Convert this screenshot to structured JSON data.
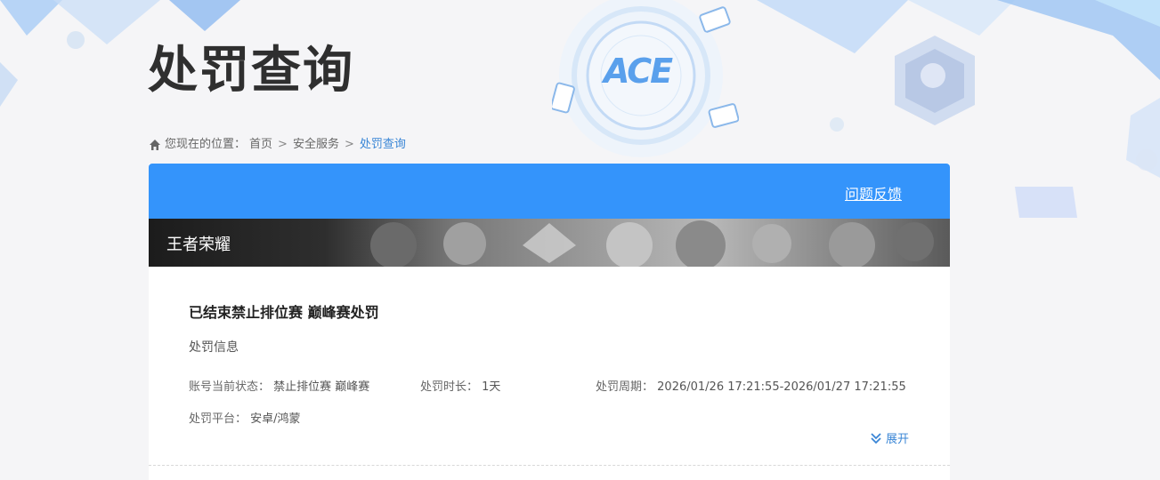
{
  "header": {
    "title": "处罚查询",
    "logo_text": "ACE"
  },
  "breadcrumb": {
    "prefix": "您现在的位置：",
    "items": [
      "首页",
      "安全服务",
      "处罚查询"
    ],
    "separator": ">"
  },
  "panel": {
    "feedback_label": "问题反馈",
    "game_name": "王者荣耀"
  },
  "penalty": {
    "title": "已结束禁止排位赛 巅峰赛处罚",
    "section_label": "处罚信息",
    "status_label": "账号当前状态：",
    "status_value": "禁止排位赛 巅峰赛",
    "duration_label": "处罚时长：",
    "duration_value": "1天",
    "period_label": "处罚周期：",
    "period_value": "2026/01/26 17:21:55-2026/01/27 17:21:55",
    "platform_label": "处罚平台：",
    "platform_value": "安卓/鸿蒙",
    "expand_label": "展开"
  },
  "colors": {
    "accent": "#3494fb",
    "link": "#3a86d6",
    "title": "#2f2f2f"
  },
  "icons": {
    "home": "home-icon",
    "expand": "double-chevron-down-icon"
  }
}
